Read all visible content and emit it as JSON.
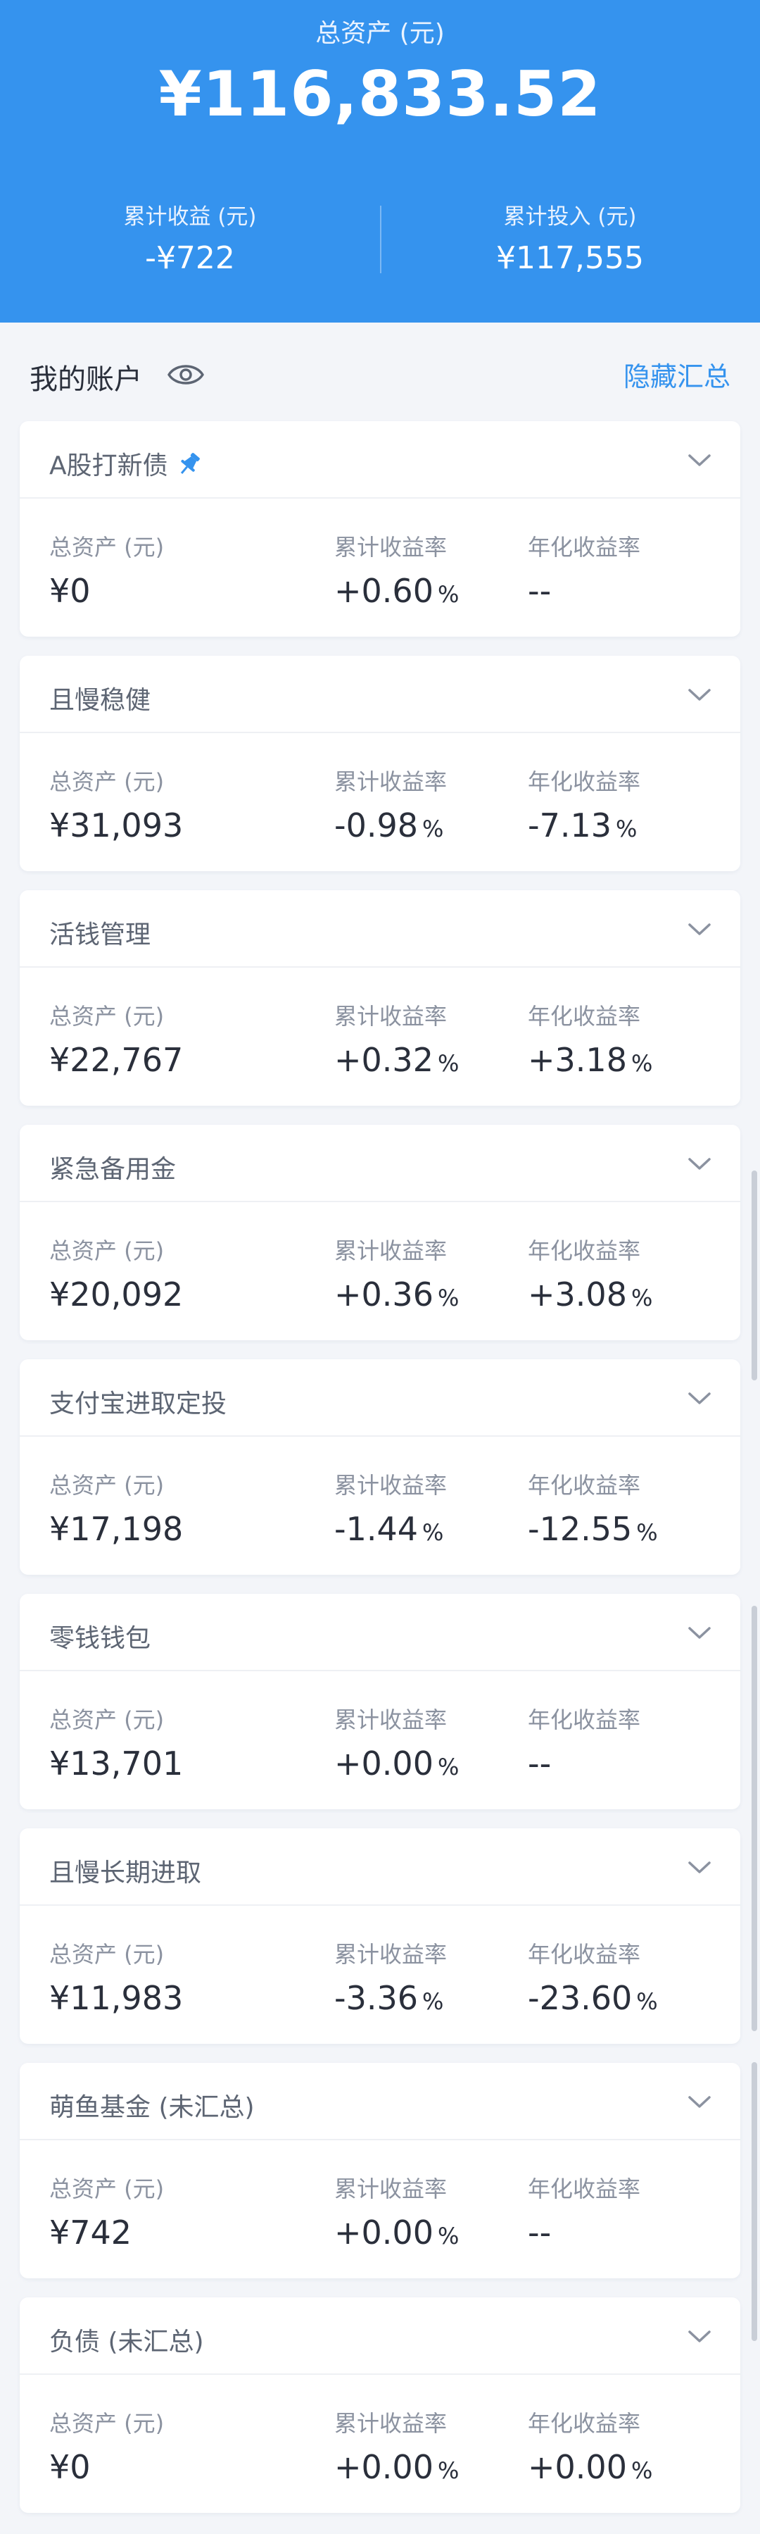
{
  "summary": {
    "total_label": "总资产 (元)",
    "total_value": "¥116,833.52",
    "profit_label": "累计收益 (元)",
    "profit_value": "-¥722",
    "invest_label": "累计投入 (元)",
    "invest_value": "¥117,555"
  },
  "section": {
    "title": "我的账户",
    "hide_label": "隐藏汇总"
  },
  "labels": {
    "assets": "总资产 (元)",
    "cum_rate": "累计收益率",
    "annual_rate": "年化收益率",
    "pct": "%"
  },
  "accounts": [
    {
      "name": "A股打新债",
      "pinned": true,
      "assets": "¥0",
      "cum": "+0.60",
      "cum_sign": "pos",
      "annual": "--",
      "annual_sign": "neu"
    },
    {
      "name": "且慢稳健",
      "pinned": false,
      "assets": "¥31,093",
      "cum": "-0.98",
      "cum_sign": "neg",
      "annual": "-7.13",
      "annual_sign": "neg"
    },
    {
      "name": "活钱管理",
      "pinned": false,
      "assets": "¥22,767",
      "cum": "+0.32",
      "cum_sign": "pos",
      "annual": "+3.18",
      "annual_sign": "pos"
    },
    {
      "name": "紧急备用金",
      "pinned": false,
      "assets": "¥20,092",
      "cum": "+0.36",
      "cum_sign": "pos",
      "annual": "+3.08",
      "annual_sign": "pos"
    },
    {
      "name": "支付宝进取定投",
      "pinned": false,
      "assets": "¥17,198",
      "cum": "-1.44",
      "cum_sign": "neg",
      "annual": "-12.55",
      "annual_sign": "neg"
    },
    {
      "name": "零钱钱包",
      "pinned": false,
      "assets": "¥13,701",
      "cum": "+0.00",
      "cum_sign": "pos",
      "annual": "--",
      "annual_sign": "neu"
    },
    {
      "name": "且慢长期进取",
      "pinned": false,
      "assets": "¥11,983",
      "cum": "-3.36",
      "cum_sign": "neg",
      "annual": "-23.60",
      "annual_sign": "neg"
    },
    {
      "name": "萌鱼基金 (未汇总)",
      "pinned": false,
      "assets": "¥742",
      "cum": "+0.00",
      "cum_sign": "pos",
      "annual": "--",
      "annual_sign": "neu"
    },
    {
      "name": "负债 (未汇总)",
      "pinned": false,
      "assets": "¥0",
      "cum": "+0.00",
      "cum_sign": "pos",
      "annual": "+0.00",
      "annual_sign": "pos"
    }
  ],
  "colors": {
    "brand": "#3593ee",
    "positive": "#ef6b58",
    "negative": "#22a98c"
  }
}
